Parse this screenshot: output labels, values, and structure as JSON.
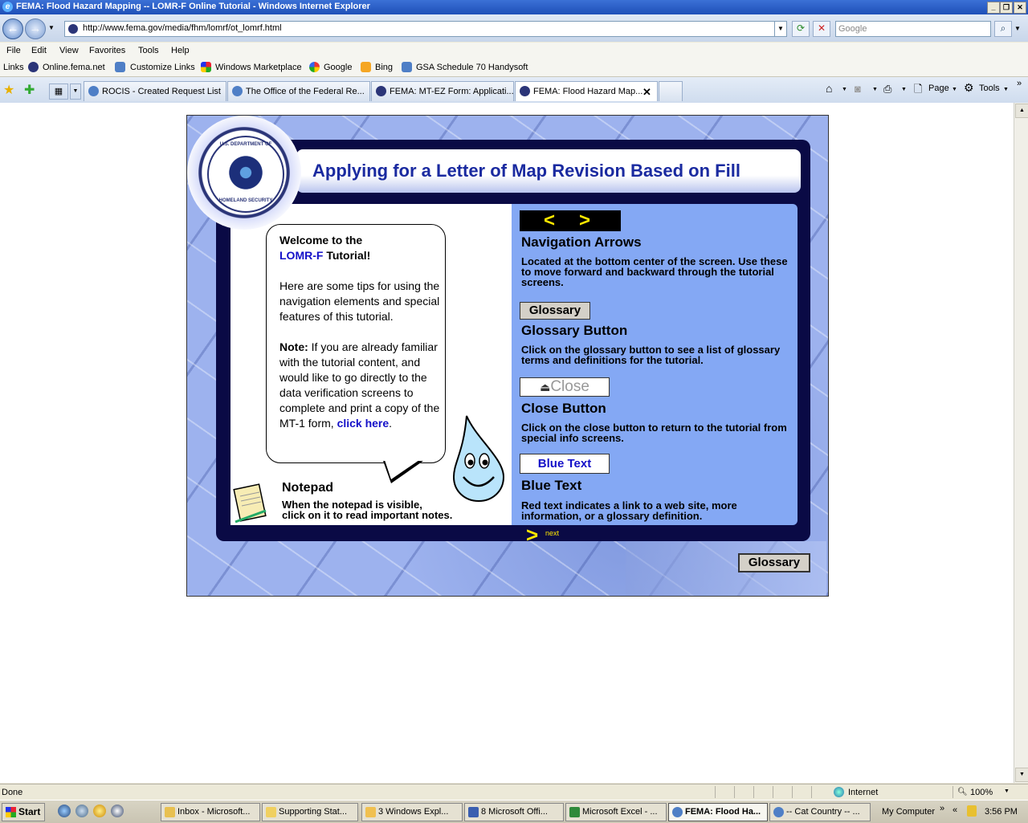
{
  "window": {
    "title": "FEMA: Flood Hazard Mapping -- LOMR-F Online Tutorial - Windows Internet Explorer"
  },
  "address": {
    "url": "http://www.fema.gov/media/fhm/lomrf/ot_lomrf.html"
  },
  "search": {
    "placeholder": "Google"
  },
  "menu": [
    "File",
    "Edit",
    "View",
    "Favorites",
    "Tools",
    "Help"
  ],
  "links_bar": {
    "label": "Links",
    "items": [
      "Online.fema.net",
      "Customize Links",
      "Windows Marketplace",
      "Google",
      "Bing",
      "GSA Schedule 70  Handysoft"
    ]
  },
  "tabs": [
    {
      "label": "ROCIS - Created Request List"
    },
    {
      "label": "The Office of the Federal Re..."
    },
    {
      "label": "FEMA: MT-EZ Form: Applicati..."
    },
    {
      "label": "FEMA: Flood Hazard Map..."
    }
  ],
  "command_bar": {
    "page": "Page",
    "tools": "Tools"
  },
  "tutorial": {
    "seal_top": "U.S. DEPARTMENT OF",
    "seal_bottom": "HOMELAND SECURITY",
    "title": "Applying for a Letter of Map Revision Based on Fill",
    "welcome_1": "Welcome to the",
    "welcome_brand": "LOMR-F",
    "welcome_2": " Tutorial!",
    "tips": "Here are some tips for using the navigation elements and special features of this tutorial.",
    "note_label": "Note:",
    "note_text": " If you are already familiar with the tutorial content, and would like to go directly to the data verification screens to complete and print a copy of the MT-1 form,",
    "click_here": "click here",
    "period": ".",
    "notepad_title": "Notepad",
    "notepad_text_1": "When the notepad is visible,",
    "notepad_text_2": "click on it to read important notes.",
    "nav_left": "<",
    "nav_right": ">",
    "nav_title": "Navigation Arrows",
    "nav_text": "Located at the bottom center of the screen. Use these to move forward and backward through the tutorial screens.",
    "glossary_btn": "Glossary",
    "glossary_title": "Glossary Button",
    "glossary_text": "Click on the glossary button to see a list of glossary terms and definitions for the tutorial.",
    "close_btn": "Close",
    "close_title": "Close Button",
    "close_text": "Click on the close button to return to the tutorial from special info screens.",
    "bluetext_btn": "Blue Text",
    "bluetext_title": "Blue Text",
    "bluetext_text": "Red text indicates a link to a web site, more information, or a glossary definition.",
    "next_arrow": ">",
    "next_label": "next",
    "glossary_bottom": "Glossary"
  },
  "status": {
    "text": "Done",
    "zone": "Internet",
    "zoom": "100%"
  },
  "taskbar": {
    "start": "Start",
    "tasks": [
      {
        "label": "Inbox - Microsoft..."
      },
      {
        "label": "Supporting Stat..."
      },
      {
        "label": "3 Windows Expl..."
      },
      {
        "label": "8 Microsoft Offi..."
      },
      {
        "label": "Microsoft Excel - ..."
      },
      {
        "label": "FEMA: Flood Ha..."
      },
      {
        "label": "-- Cat Country -- ..."
      }
    ],
    "my_computer": "My Computer",
    "clock": "3:56 PM"
  },
  "colors": {
    "title_blue": "#1a2aa0",
    "panel_blue": "#84a8f4",
    "frame_navy": "#0a0a45",
    "arrow_yellow": "#ffe800",
    "link_blue": "#1410c8"
  }
}
